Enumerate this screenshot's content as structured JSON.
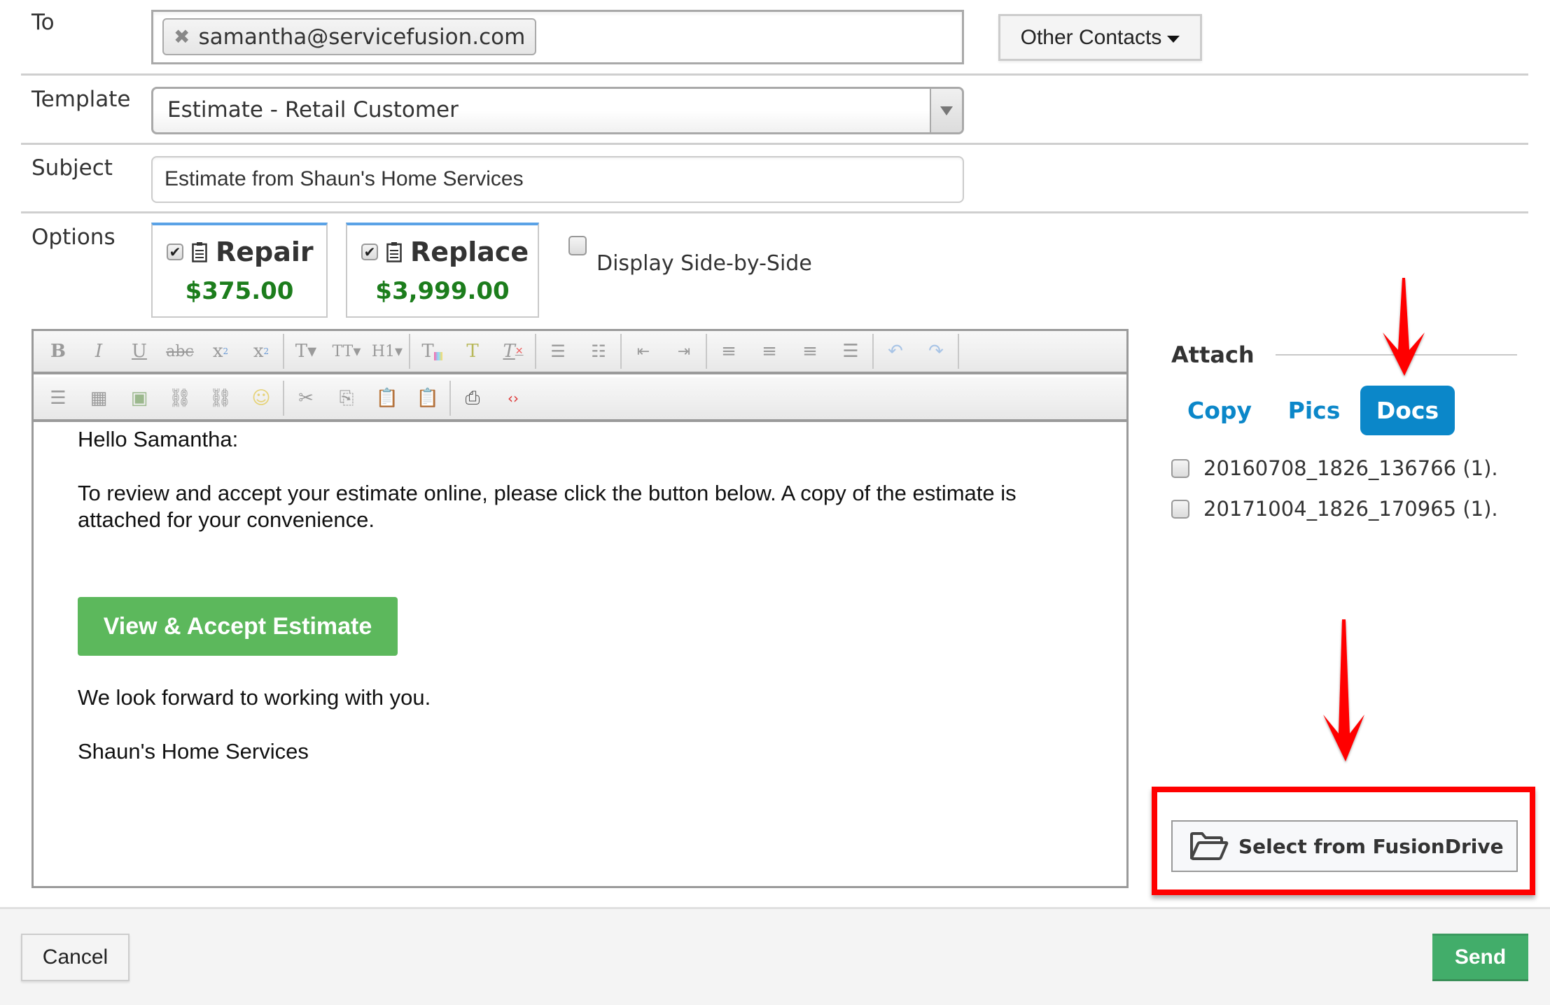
{
  "form": {
    "to": {
      "label": "To",
      "recipients": [
        "samantha@servicefusion.com"
      ],
      "other_contacts_label": "Other Contacts"
    },
    "template": {
      "label": "Template",
      "selected": "Estimate - Retail Customer"
    },
    "subject": {
      "label": "Subject",
      "value": "Estimate from Shaun's Home Services"
    },
    "options": {
      "label": "Options",
      "items": [
        {
          "title": "Repair",
          "price": "$375.00",
          "checked": true
        },
        {
          "title": "Replace",
          "price": "$3,999.00",
          "checked": true
        }
      ],
      "side_by_side_label": "Display Side-by-Side",
      "side_by_side_checked": false
    }
  },
  "editor": {
    "toolbar_row1": [
      "bold",
      "italic",
      "underline",
      "strikethrough",
      "subscript",
      "superscript",
      "|",
      "font-family",
      "font-size",
      "heading",
      "|",
      "text-color",
      "highlight-color",
      "remove-format",
      "|",
      "bullet-list",
      "numbered-list",
      "|",
      "outdent",
      "indent",
      "|",
      "align-left",
      "align-center",
      "align-right",
      "justify",
      "|",
      "undo",
      "redo"
    ],
    "toolbar_row2": [
      "horizontal-rule",
      "table",
      "image",
      "link",
      "unlink",
      "emoji",
      "|",
      "cut",
      "copy",
      "paste",
      "paste-text",
      "|",
      "print",
      "source-code"
    ],
    "body": {
      "greeting": "Hello Samantha:",
      "paragraph": "To review and accept your estimate online, please click the button below. A copy of the estimate is attached for your convenience.",
      "button_label": "View & Accept Estimate",
      "closing": "We look forward to working with you.",
      "signature": "Shaun's Home Services"
    }
  },
  "attach": {
    "title": "Attach",
    "tabs": [
      {
        "label": "Copy",
        "active": false
      },
      {
        "label": "Pics",
        "active": false
      },
      {
        "label": "Docs",
        "active": true
      }
    ],
    "files": [
      {
        "name": "20160708_1826_136766 (1).",
        "checked": false
      },
      {
        "name": "20171004_1826_170965 (1).",
        "checked": false
      }
    ],
    "fusiondrive_label": "Select from FusionDrive"
  },
  "footer": {
    "cancel_label": "Cancel",
    "send_label": "Send"
  },
  "colors": {
    "accent_blue": "#0b87c9",
    "price_green": "#1c7d1c",
    "accept_green": "#5cb85c",
    "send_green": "#42ad6a",
    "annotation_red": "#ff0000"
  }
}
